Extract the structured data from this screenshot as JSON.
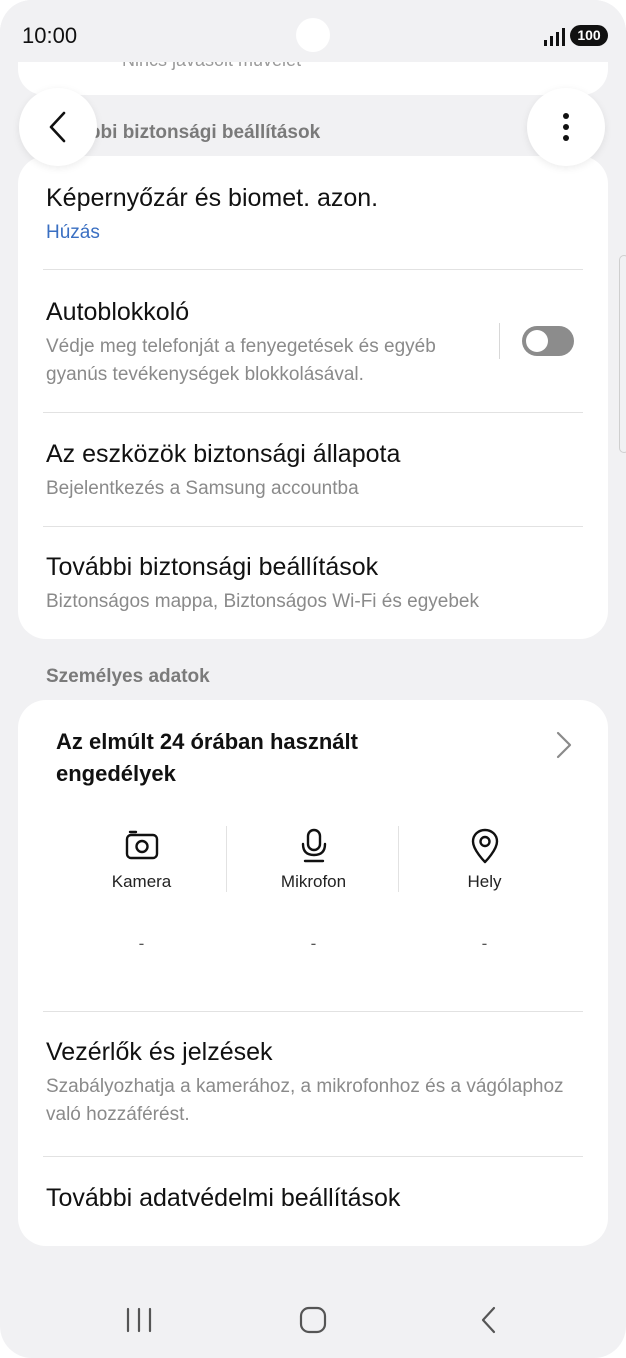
{
  "status_bar": {
    "time": "10:00",
    "battery": "100",
    "signal_icon": "signal-bars-icon"
  },
  "prev_card": {
    "text": "Nincs javasolt művelet"
  },
  "header": {
    "title": "További biztonsági beállítások"
  },
  "security_card": {
    "items": [
      {
        "title": "Képernyőzár és biomet. azon.",
        "subtitle": "Húzás"
      },
      {
        "title": "Autoblokkoló",
        "subtitle": "Védje meg telefonját a fenyegetések és egyéb gyanús tevékenységek blokkolásával.",
        "toggle_on": false
      },
      {
        "title": "Az eszközök biztonsági állapota",
        "subtitle": "Bejelentkezés a Samsung accountba"
      },
      {
        "title": "További biztonsági beállítások",
        "subtitle": "Biztonságos mappa, Biztonságos Wi-Fi és egyebek"
      }
    ]
  },
  "privacy_section": {
    "label": "Személyes adatok"
  },
  "privacy_card": {
    "permissions_title": "Az elmúlt 24 órában használt engedélyek",
    "permissions": [
      {
        "label": "Kamera",
        "value": "-",
        "icon": "camera-icon"
      },
      {
        "label": "Mikrofon",
        "value": "-",
        "icon": "microphone-icon"
      },
      {
        "label": "Hely",
        "value": "-",
        "icon": "location-pin-icon"
      }
    ],
    "items": [
      {
        "title": "Vezérlők és jelzések",
        "subtitle": "Szabályozhatja a kamerához, a mikrofonhoz és a vágólaphoz való hozzáférést."
      },
      {
        "title": "További adatvédelmi beállítások"
      }
    ]
  },
  "colors": {
    "background": "#f1f1f3",
    "card": "#ffffff",
    "link_blue": "#3a6fc2",
    "toggle_off": "#8c8c8c"
  }
}
